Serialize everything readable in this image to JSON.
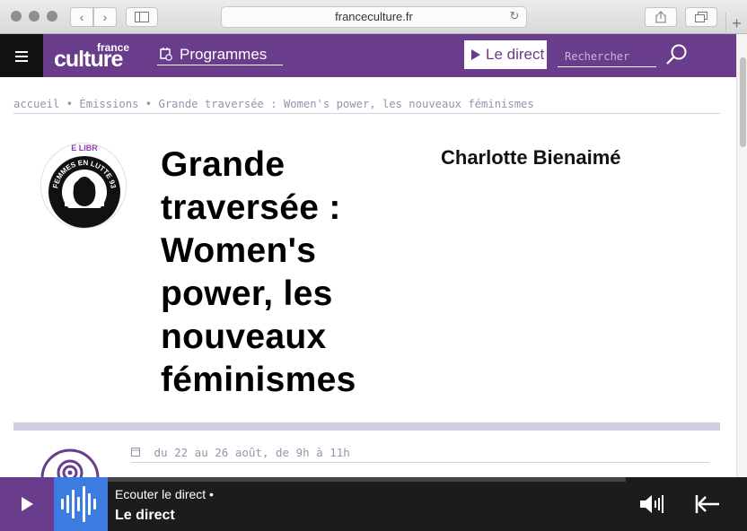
{
  "browser": {
    "url": "franceculture.fr"
  },
  "header": {
    "logo_top": "france",
    "logo_main": "culture",
    "programmes_label": "Programmes",
    "direct_label": "Le direct",
    "search_placeholder": "Rechercher",
    "brand_color": "#6a3c8c"
  },
  "breadcrumb": {
    "home": "accueil",
    "emissions": "Émissions",
    "current": "Grande traversée : Women's power, les nouveaux féminismes",
    "separator": "•"
  },
  "show": {
    "title": "Grande traversée : Women's power, les nouveaux féminismes",
    "producer": "Charlotte Bienaimé",
    "image_text": "FEMMES EN LUTTE 93",
    "image_text_top": "E LIBR",
    "schedule": "du 22 au 26 août, de 9h à 11h"
  },
  "player": {
    "subtitle": "Ecouter le direct •",
    "title": "Le direct",
    "accent_color": "#3c7be0"
  }
}
